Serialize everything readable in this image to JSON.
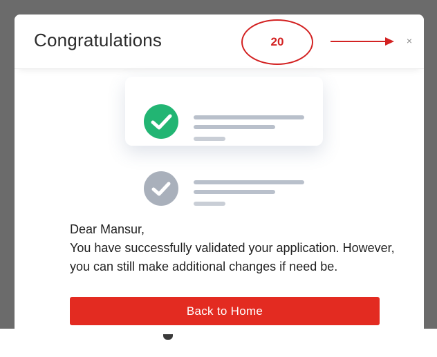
{
  "modal": {
    "title": "Congratulations",
    "close_glyph": "×",
    "greeting": "Dear Mansur,",
    "message": "You have successfully validated your application. However, you can still make additional changes if need be.",
    "primary_button_label": "Back to Home"
  },
  "annotation": {
    "number": "20",
    "color": "#d32222"
  },
  "illustration": {
    "items": [
      {
        "icon": "check-circle-icon",
        "state": "completed",
        "color": "#22b573"
      },
      {
        "icon": "check-circle-icon",
        "state": "pending",
        "color": "#a9b0bb"
      }
    ]
  },
  "colors": {
    "primary": "#e32b21",
    "success": "#22b573",
    "muted": "#a9b0bb",
    "backdrop": "#6b6b6b"
  }
}
